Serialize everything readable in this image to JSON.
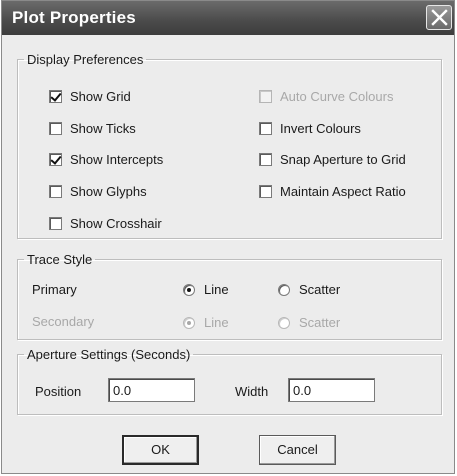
{
  "window": {
    "title": "Plot Properties"
  },
  "display_preferences": {
    "legend": "Display Preferences",
    "checkboxes": [
      {
        "label": "Show Grid",
        "checked": true,
        "enabled": true
      },
      {
        "label": "Show Ticks",
        "checked": false,
        "enabled": true
      },
      {
        "label": "Show Intercepts",
        "checked": true,
        "enabled": true
      },
      {
        "label": "Show Glyphs",
        "checked": false,
        "enabled": true
      },
      {
        "label": "Show Crosshair",
        "checked": false,
        "enabled": true
      },
      {
        "label": "Auto Curve Colours",
        "checked": false,
        "enabled": false
      },
      {
        "label": "Invert Colours",
        "checked": false,
        "enabled": true
      },
      {
        "label": "Snap Aperture to Grid",
        "checked": false,
        "enabled": true
      },
      {
        "label": "Maintain Aspect Ratio",
        "checked": false,
        "enabled": true
      }
    ]
  },
  "trace_style": {
    "legend": "Trace Style",
    "rows": [
      {
        "label": "Primary",
        "enabled": true,
        "options": [
          {
            "label": "Line",
            "selected": true
          },
          {
            "label": "Scatter",
            "selected": false
          }
        ]
      },
      {
        "label": "Secondary",
        "enabled": false,
        "options": [
          {
            "label": "Line",
            "selected": true
          },
          {
            "label": "Scatter",
            "selected": false
          }
        ]
      }
    ]
  },
  "aperture_settings": {
    "legend": "Aperture Settings (Seconds)",
    "position": {
      "label": "Position",
      "value": "0.0"
    },
    "width": {
      "label": "Width",
      "value": "0.0"
    }
  },
  "buttons": {
    "ok": "OK",
    "cancel": "Cancel"
  },
  "icons": {
    "close": "close-icon"
  }
}
